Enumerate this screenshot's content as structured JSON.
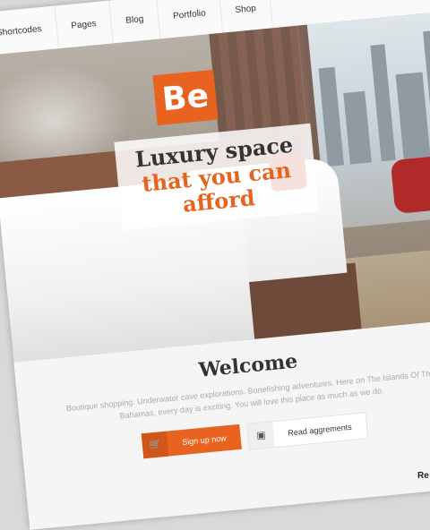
{
  "nav": {
    "items": [
      "Shortcodes",
      "Pages",
      "Blog",
      "Portfolio",
      "Shop"
    ]
  },
  "hero": {
    "logo_text": "Be",
    "slogan_line1": "Luxury space",
    "slogan_line2": "that you can",
    "slogan_line3": "afford"
  },
  "welcome": {
    "title": "Welcome",
    "body": "Boutique shopping. Underwater cave explorations. Bonefishing adventures. Here on The Islands Of The Bahamas, every day is exciting. You will love this place as much as we do.",
    "primary_button": "Sign up now",
    "primary_icon": "cart-icon",
    "secondary_button": "Read aggrements",
    "secondary_icon": "document-icon"
  },
  "corner": {
    "text": "Re"
  },
  "colors": {
    "accent": "#e8631f",
    "text_dark": "#333333"
  }
}
